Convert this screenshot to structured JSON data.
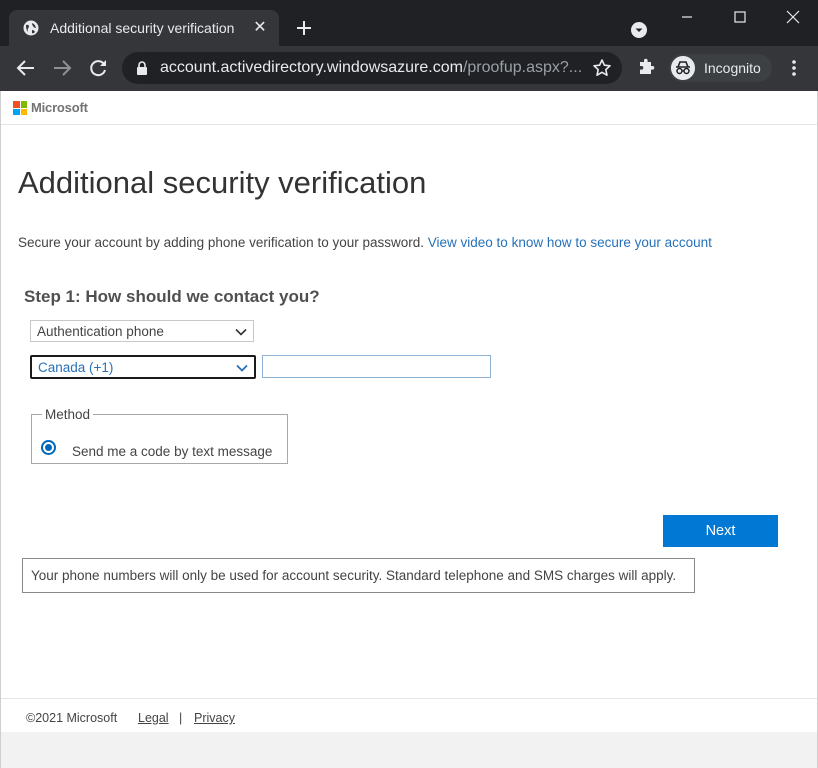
{
  "browser": {
    "tab": {
      "title": "Additional security verification",
      "close_glyph": "✕"
    },
    "url_host": "account.activedirectory.windowsazure.com",
    "url_path": "/proofup.aspx?...",
    "profile_label": "Incognito",
    "icons": [
      "globe-icon",
      "new-tab-icon",
      "tab-search-icon",
      "minimize-icon",
      "maximize-icon",
      "close-icon",
      "back-icon",
      "forward-icon",
      "reload-icon",
      "lock-icon",
      "star-icon",
      "extensions-icon",
      "incognito-icon",
      "menu-icon"
    ]
  },
  "header": {
    "brand": "Microsoft"
  },
  "main": {
    "title": "Additional security verification",
    "intro_text": "Secure your account by adding phone verification to your password.",
    "intro_link": "View video to know how to secure your account",
    "step_heading": "Step 1: How should we contact you?",
    "contact_method_value": "Authentication phone",
    "country_value": "Canada (+1)",
    "phone_value": "",
    "method_legend": "Method",
    "method_option": "Send me a code by text message",
    "method_selected": true,
    "next_label": "Next",
    "notice": "Your phone numbers will only be used for account security. Standard telephone and SMS charges will apply."
  },
  "footer": {
    "copyright": "©2021 Microsoft",
    "legal": "Legal",
    "separator": "|",
    "privacy": "Privacy"
  },
  "colors": {
    "browser_frame": "#202124",
    "toolbar": "#35363a",
    "link": "#2672b9",
    "primary_button": "#0078d4",
    "ms_red": "#f25022",
    "ms_green": "#7fba00",
    "ms_blue": "#00a4ef",
    "ms_yellow": "#ffb900"
  }
}
